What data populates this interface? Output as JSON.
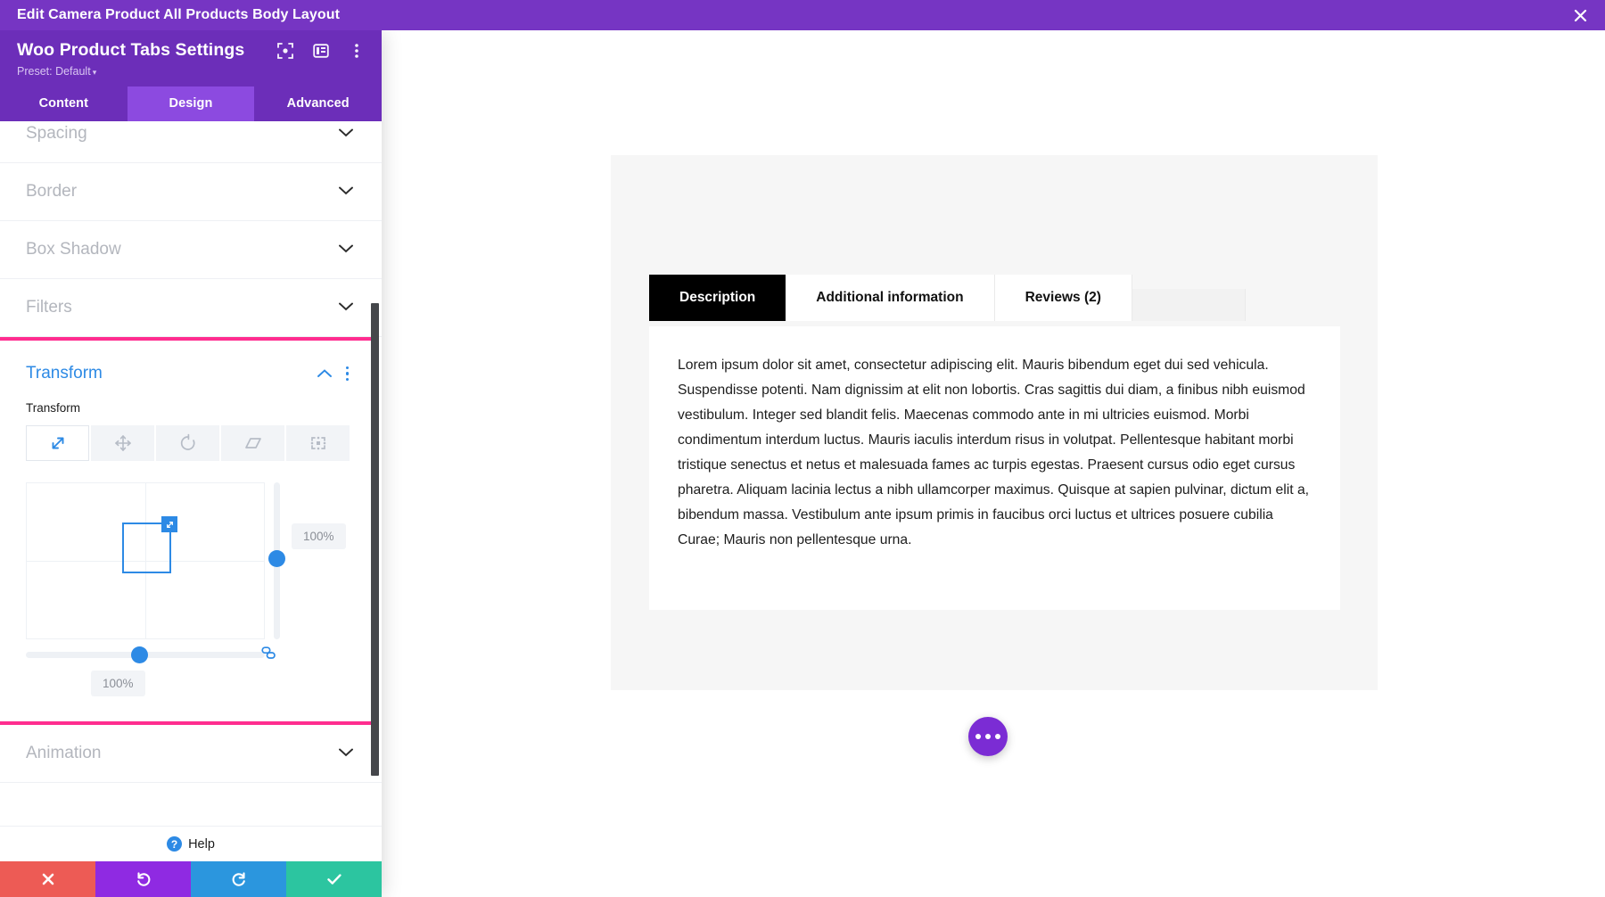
{
  "edit_bar": {
    "title": "Edit Camera Product All Products Body Layout",
    "close_label": "✕"
  },
  "panel": {
    "title": "Woo Product Tabs Settings",
    "preset_label": "Preset: Default",
    "preset_caret": "▾",
    "header_icons": [
      {
        "name": "focus-icon",
        "label": "Focus"
      },
      {
        "name": "layout-panel-icon",
        "label": "Panel Layout"
      },
      {
        "name": "more-vertical-icon",
        "label": "More Options"
      }
    ],
    "tabs": [
      {
        "label": "Content",
        "active": false
      },
      {
        "label": "Design",
        "active": true
      },
      {
        "label": "Advanced",
        "active": false
      }
    ],
    "accordions": [
      {
        "label": "Spacing"
      },
      {
        "label": "Border"
      },
      {
        "label": "Box Shadow"
      },
      {
        "label": "Filters"
      },
      {
        "label": "Animation"
      }
    ],
    "help_label": "Help",
    "help_badge": "?",
    "actions": [
      {
        "name": "cancel-button",
        "icon": "✖",
        "color": "#ed5b55"
      },
      {
        "name": "undo-button",
        "icon": "↺",
        "color": "#8f2ae2"
      },
      {
        "name": "redo-button",
        "icon": "↻",
        "color": "#2b96de"
      },
      {
        "name": "save-button",
        "icon": "✔",
        "color": "#2cc5a0"
      }
    ]
  },
  "transform": {
    "section_title": "Transform",
    "field_label": "Transform",
    "collapse_caret": "⌃",
    "highlight_color": "#ff2d8f",
    "accent_color": "#2d8ae5",
    "modes": [
      {
        "name": "scale-mode",
        "label": "Scale",
        "active": true
      },
      {
        "name": "translate-mode",
        "label": "Translate",
        "active": false
      },
      {
        "name": "rotate-mode",
        "label": "Rotate",
        "active": false
      },
      {
        "name": "skew-mode",
        "label": "Skew",
        "active": false
      },
      {
        "name": "origin-mode",
        "label": "Transform Origin",
        "active": false
      }
    ],
    "scale_y_value": "100%",
    "scale_x_value": "100%",
    "link_state": "linked"
  },
  "preview": {
    "tabs": [
      {
        "label": "Description",
        "active": true
      },
      {
        "label": "Additional information",
        "active": false
      },
      {
        "label": "Reviews (2)",
        "active": false
      }
    ],
    "body_text": "Lorem ipsum dolor sit amet, consectetur adipiscing elit. Mauris bibendum eget dui sed vehicula. Suspendisse potenti. Nam dignissim at elit non lobortis. Cras sagittis dui diam, a finibus nibh euismod vestibulum. Integer sed blandit felis. Maecenas commodo ante in mi ultricies euismod. Morbi condimentum interdum luctus. Mauris iaculis interdum risus in volutpat. Pellentesque habitant morbi tristique senectus et netus et malesuada fames ac turpis egestas. Praesent cursus odio eget cursus pharetra. Aliquam lacinia lectus a nibh ullamcorper maximus. Quisque at sapien pulvinar, dictum elit a, bibendum massa. Vestibulum ante ipsum primis in faucibus orci luctus et ultrices posuere cubilia Curae; Mauris non pellentesque urna.",
    "fab_label": "More Actions"
  }
}
